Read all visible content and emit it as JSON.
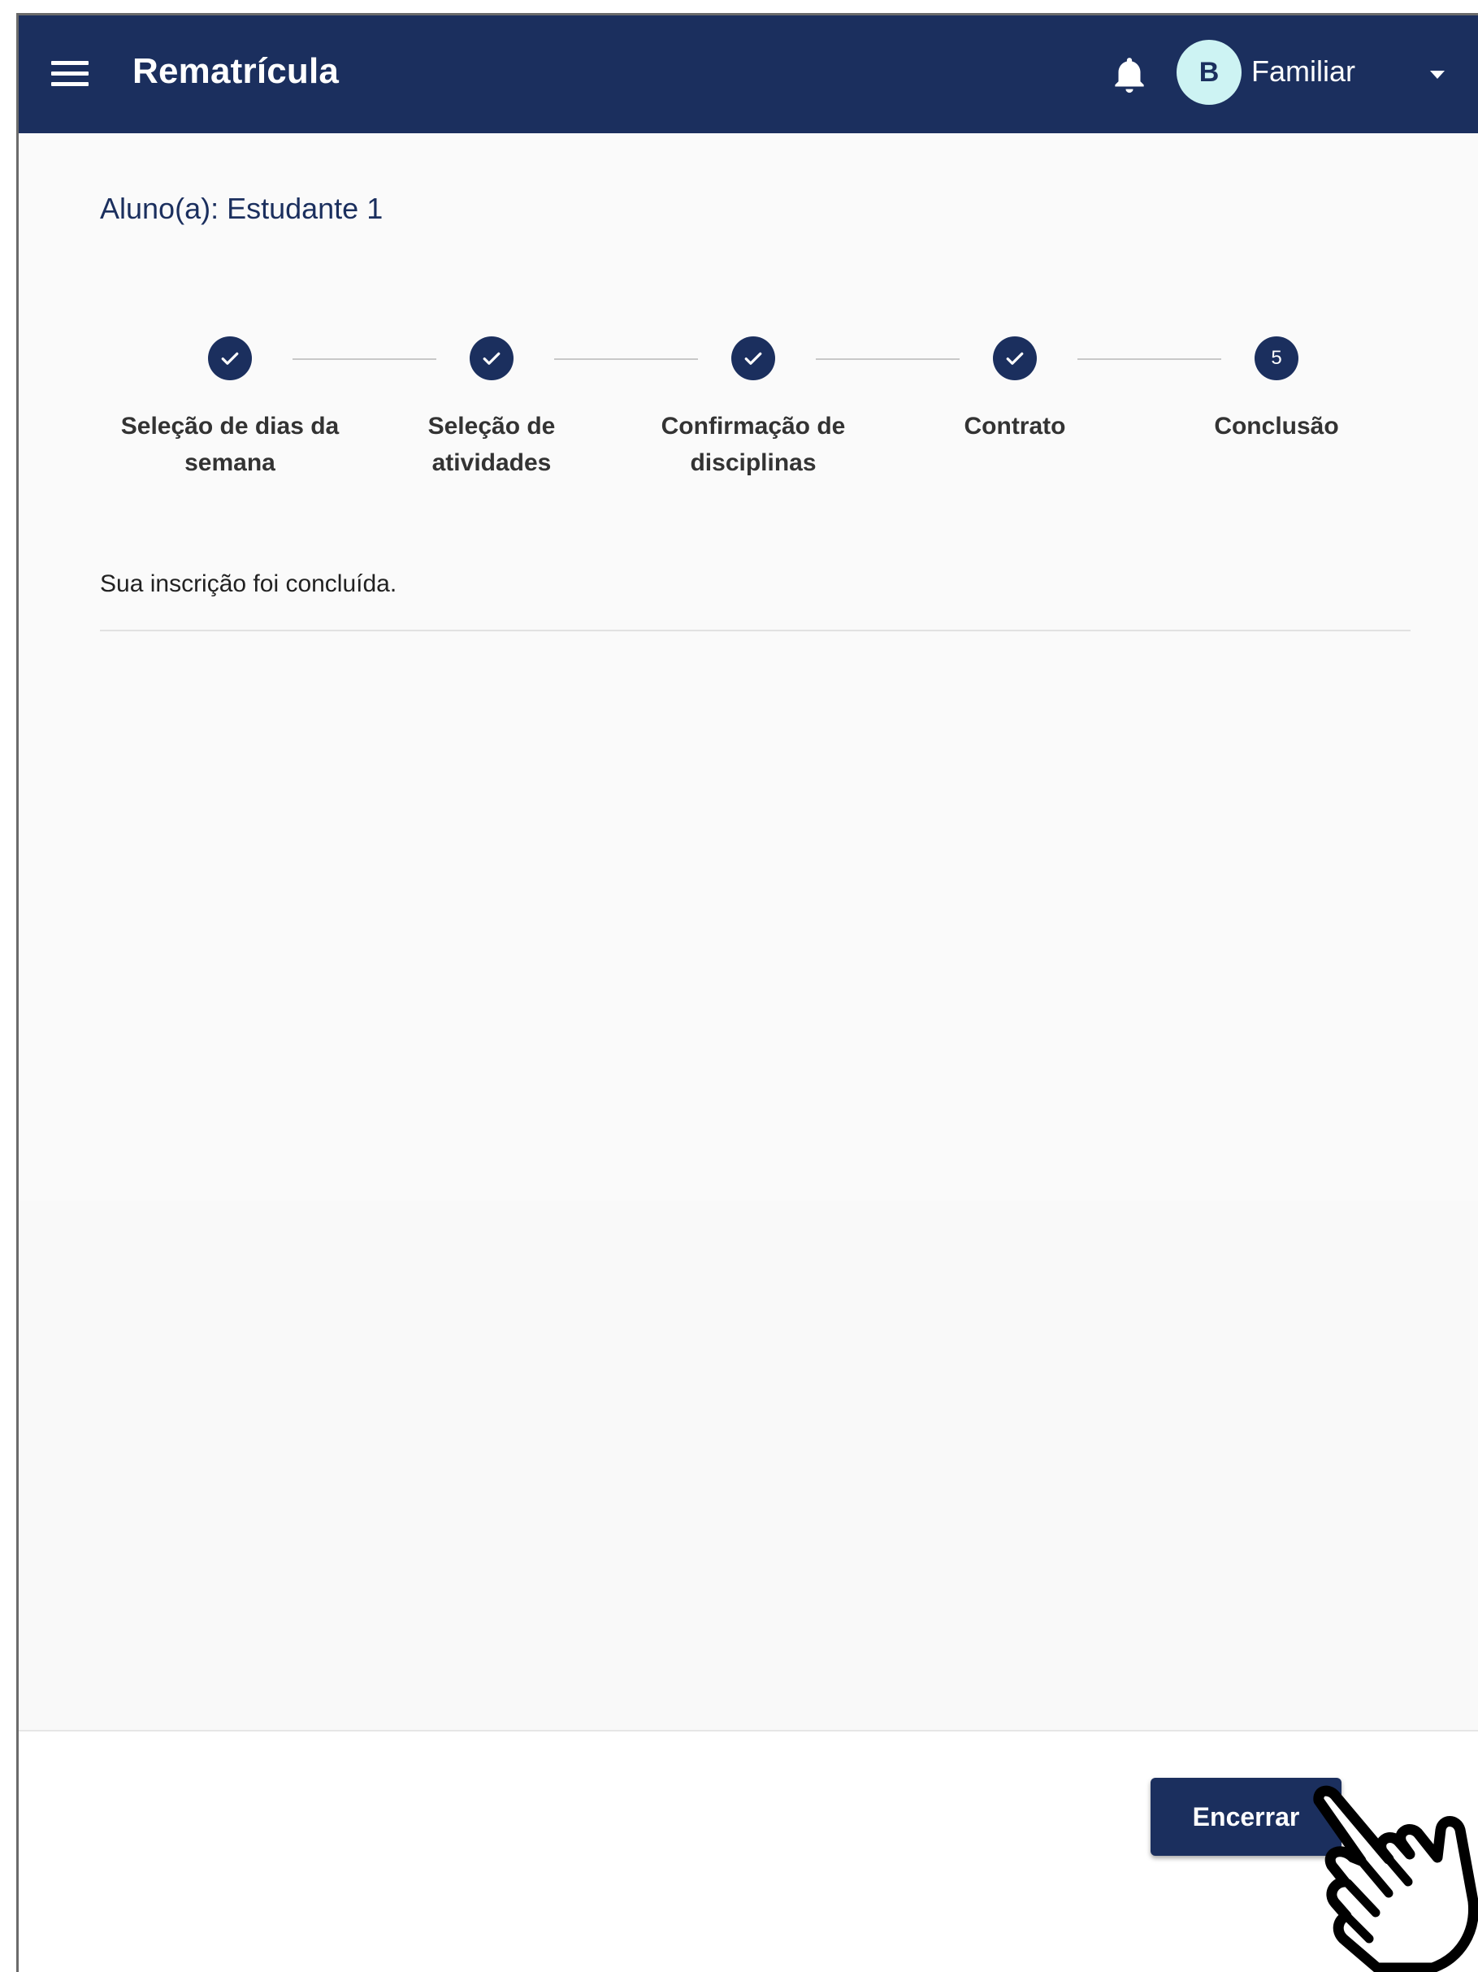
{
  "appbar": {
    "title": "Rematrícula",
    "user_initial": "B",
    "user_name": "Familiar",
    "icons": [
      "menu-icon",
      "bell-icon",
      "chevron-down-icon"
    ]
  },
  "main": {
    "student_label": "Aluno(a): Estudante 1",
    "steps": [
      {
        "label": "Seleção de dias da semana",
        "status": "done"
      },
      {
        "label": "Seleção de atividades",
        "status": "done"
      },
      {
        "label": "Confirmação de disciplinas",
        "status": "done"
      },
      {
        "label": "Contrato",
        "status": "done"
      },
      {
        "label": "Conclusão",
        "status": "current",
        "number": "5"
      }
    ],
    "message": "Sua inscrição foi concluída."
  },
  "footer": {
    "finish_label": "Encerrar"
  },
  "colors": {
    "primary": "#1b2f5e",
    "avatar_bg": "#cdf3f3",
    "background": "#fafafa"
  }
}
